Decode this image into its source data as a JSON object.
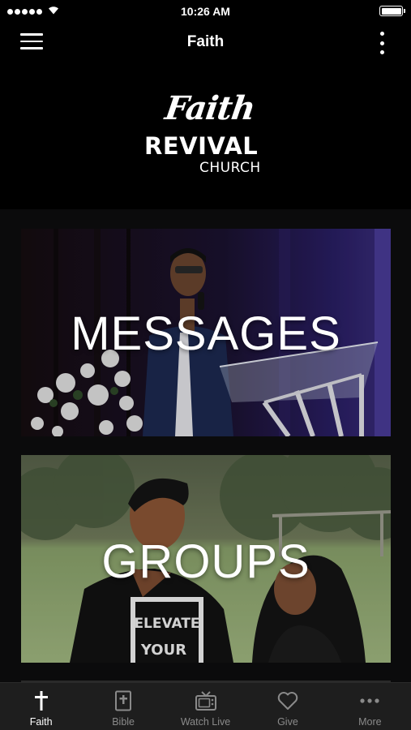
{
  "status_bar": {
    "time": "10:26 AM"
  },
  "nav": {
    "title": "Faith"
  },
  "logo": {
    "script": "Faith",
    "word": "REVIVAL",
    "sub": "CHURCH"
  },
  "tiles": [
    {
      "label": "MESSAGES"
    },
    {
      "label": "GROUPS"
    }
  ],
  "photo_text": {
    "shirt_line1": "ELEVATE",
    "shirt_line2": "YOUR"
  },
  "tabs": [
    {
      "label": "Faith",
      "icon": "cross-icon",
      "active": true
    },
    {
      "label": "Bible",
      "icon": "bible-icon",
      "active": false
    },
    {
      "label": "Watch Live",
      "icon": "tv-icon",
      "active": false
    },
    {
      "label": "Give",
      "icon": "heart-icon",
      "active": false
    },
    {
      "label": "More",
      "icon": "more-dots-icon",
      "active": false
    }
  ],
  "colors": {
    "background": "#000000",
    "tab_bar": "#1e1e1e",
    "active_tab": "#ffffff",
    "inactive_tab": "#8a8a8a"
  }
}
